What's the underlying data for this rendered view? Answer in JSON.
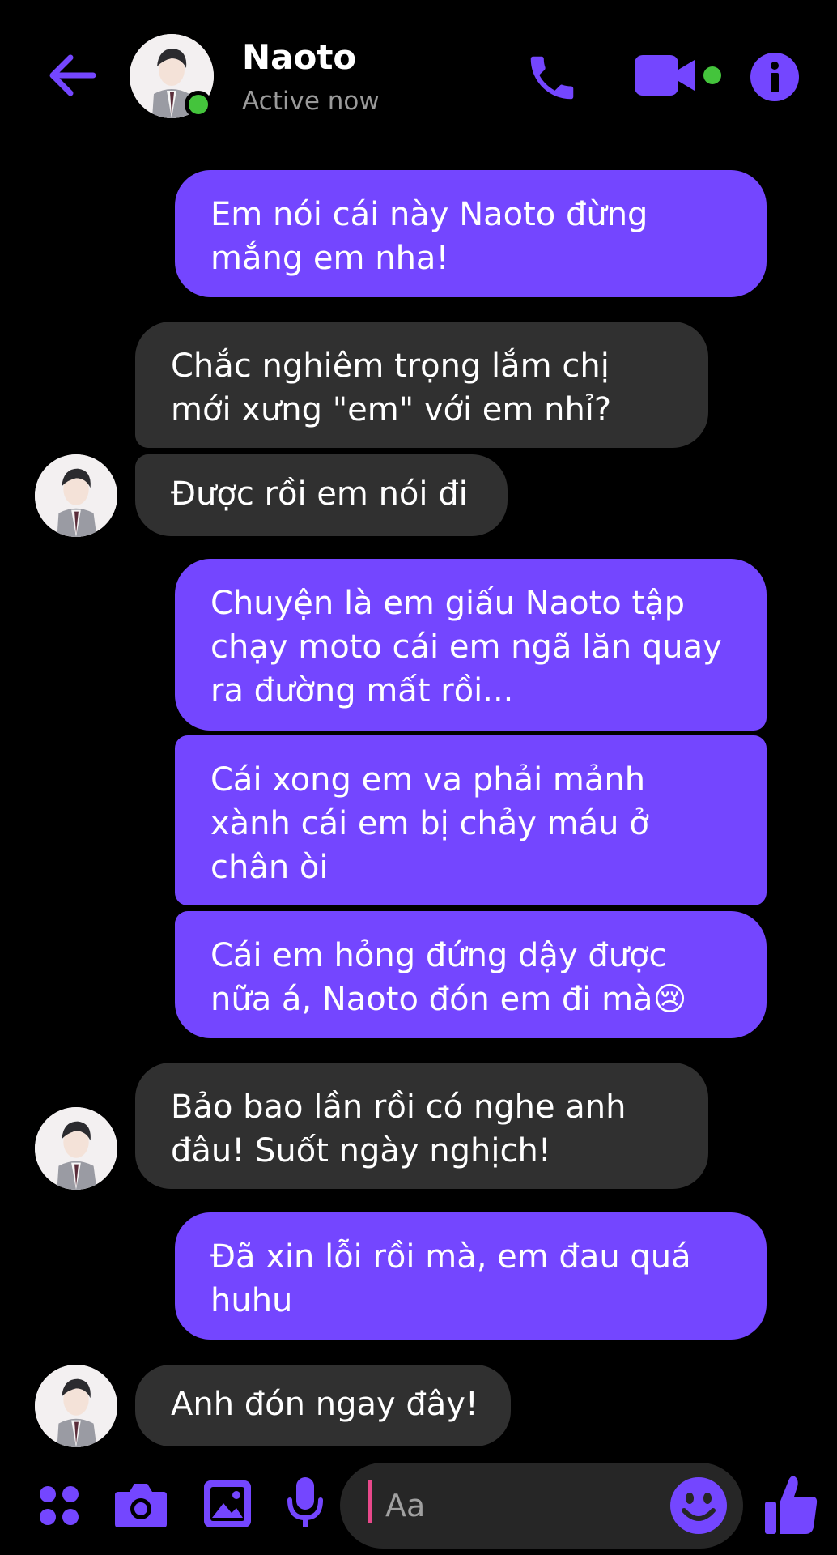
{
  "theme": {
    "accent": "#7446ff",
    "sent_bubble": "#7446ff",
    "received_bubble": "#303030",
    "online": "#44c43c",
    "background": "#000000"
  },
  "header": {
    "name": "Naoto",
    "status": "Active now",
    "icons": [
      "back-arrow-icon",
      "phone-icon",
      "video-camera-icon",
      "info-icon"
    ]
  },
  "messages": [
    {
      "side": "sent",
      "text": "Em nói cái này Naoto đừng\nmắng em nha!"
    },
    {
      "side": "received",
      "text": "Chắc nghiêm trọng lắm chị\nmới xưng \"em\" với em nhỉ?"
    },
    {
      "side": "received",
      "text": "Được rồi em nói đi"
    },
    {
      "side": "sent",
      "text": "Chuyện là em giấu Naoto tập\nchạy moto cái em ngã lăn quay\nra đường mất rồi..."
    },
    {
      "side": "sent",
      "text": "Cái xong em va phải mảnh\nxành cái em bị chảy máu ở\nchân òi"
    },
    {
      "side": "sent",
      "text": "Cái em hỏng đứng dậy được\nnữa á, Naoto đón em đi mà😢"
    },
    {
      "side": "received",
      "text": "Bảo bao lần rồi có nghe anh\nđâu! Suốt ngày nghịch!"
    },
    {
      "side": "sent",
      "text": "Đã xin lỗi rồi mà, em đau quá\nhuhu"
    },
    {
      "side": "received",
      "text": "Anh đón ngay đây!"
    }
  ],
  "composer": {
    "placeholder": "Aa",
    "icons": [
      "apps-grid-icon",
      "camera-icon",
      "image-icon",
      "microphone-icon",
      "emoji-icon",
      "thumbs-up-icon"
    ]
  }
}
